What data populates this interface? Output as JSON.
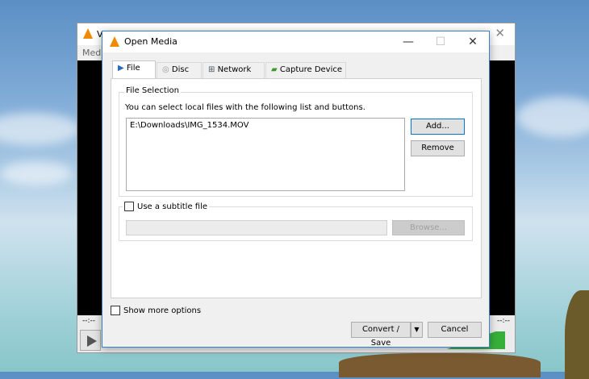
{
  "background_window": {
    "title_fragment": "V",
    "menu_fragment": "Medi",
    "time_left": "--:--",
    "time_right": "--:--"
  },
  "dialog": {
    "title": "Open Media",
    "tabs": [
      {
        "label": "File"
      },
      {
        "label": "Disc"
      },
      {
        "label": "Network"
      },
      {
        "label": "Capture Device"
      }
    ],
    "file_selection": {
      "group_label": "File Selection",
      "instruction": "You can select local files with the following list and buttons.",
      "files": [
        "E:\\Downloads\\IMG_1534.MOV"
      ],
      "add_label": "Add...",
      "remove_label": "Remove"
    },
    "subtitle": {
      "checkbox_label": "Use a subtitle file",
      "checked": false,
      "path_value": "",
      "browse_label": "Browse..."
    },
    "show_more_options": {
      "label": "Show more options",
      "checked": false
    },
    "convert_save_label": "Convert / Save",
    "cancel_label": "Cancel"
  },
  "colors": {
    "accent": "#0078d7",
    "vlc_orange": "#f08a00"
  }
}
